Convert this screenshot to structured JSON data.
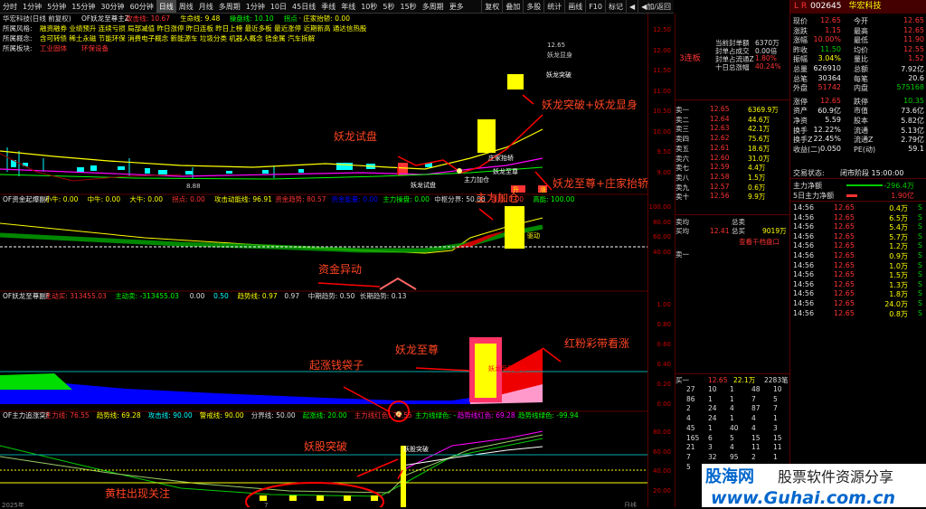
{
  "toolbar": {
    "name": "华宏科技(日线 前复权)",
    "periods": [
      "分时",
      "1分钟",
      "5分钟",
      "15分钟",
      "30分钟",
      "60分钟",
      "日线",
      "周线",
      "月线",
      "多周期",
      "1分钟",
      "10日",
      "45日线",
      "季线",
      "年线",
      "10秒",
      "5秒",
      "15秒",
      "多周期",
      "更多"
    ],
    "active": "日线",
    "right": [
      "复权",
      "叠加",
      "多股",
      "统计",
      "画线",
      "F10",
      "标记",
      "◀",
      "◀加/返回"
    ]
  },
  "main_chart": {
    "legend": [
      {
        "t": "OF妖龙至尊主Z",
        "c": "#eee"
      },
      {
        "t": "攻击线: 10.67",
        "c": "#f33"
      },
      {
        "t": "生命线: 9.48",
        "c": "#ff0"
      },
      {
        "t": "操盘线: 10.10",
        "c": "#0f0"
      },
      {
        "t": "拐点",
        "c": "#0f0"
      },
      {
        "t": "· 庄家抬轿: 0.00",
        "c": "#ff0"
      }
    ],
    "info": [
      {
        "k": "所属风格:",
        "v": "融资融券 业绩预升 连续亏损 局部减值 昨日涨停 昨日连板 昨日上榜 最近多板 最近涨停 近期新高 通达信热股"
      },
      {
        "k": "所属概念:",
        "v": "含可转债 稀土永磁 节能环保 消费电子概念 新能源车 垃圾分类 机器人概念 锆金属 汽车拆解"
      },
      {
        "k": "所属板块:",
        "v": "工业固体",
        "v2": "环保设备"
      }
    ],
    "y_ticks": [
      "12.50",
      "12.00",
      "11.50",
      "11.00",
      "10.50",
      "10.00",
      "9.50",
      "9.00"
    ],
    "marks": {
      "price_top": "12.65",
      "yaolong_show": "妖龙显身",
      "yaolong_break": "妖龙突破",
      "zhuang": "庄家抬轿",
      "zhizun": "妖龙至尊",
      "zhuli": "主力加仓",
      "shipan": "妖龙试盘",
      "low": "8.88",
      "t1": "升",
      "t2": "涨"
    }
  },
  "sub1": {
    "legend": [
      {
        "t": "OF资金起爆副F",
        "c": "#eee"
      },
      {
        "t": "小牛: 0.00",
        "c": "#ff0"
      },
      {
        "t": "中牛: 0.00",
        "c": "#ff0"
      },
      {
        "t": "大牛: 0.00",
        "c": "#ff0"
      },
      {
        "t": "拐点: 0.00",
        "c": "#f33"
      },
      {
        "t": "攻击动能线: 96.91",
        "c": "#ff0"
      },
      {
        "t": "资金趋势: 80.57",
        "c": "#f33"
      },
      {
        "t": "资金能量: 0.00",
        "c": "#00f"
      },
      {
        "t": "主力操盘: 0.00",
        "c": "#0f0"
      },
      {
        "t": "中枢分界: 50.00",
        "c": "#ddd"
      },
      {
        "t": "强势: 0.00",
        "c": "#f33"
      },
      {
        "t": "高能: 100.00",
        "c": "#0f0"
      }
    ],
    "y_ticks": [
      "100.00",
      "80.00",
      "60.00",
      "40.00"
    ],
    "marks": {
      "sig": "资金异动",
      "b1": "妖龙",
      "b2": "驱动"
    }
  },
  "sub2": {
    "legend": [
      {
        "t": "OF妖龙至尊副F",
        "c": "#eee"
      },
      {
        "t": "主动买: 313455.03",
        "c": "#f33"
      },
      {
        "t": "主动卖: -313455.03",
        "c": "#0f0"
      },
      {
        "t": "0.00",
        "c": "#ddd"
      },
      {
        "t": "0.50",
        "c": "#0ff"
      },
      {
        "t": "趋势线: 0.97",
        "c": "#ff0"
      },
      {
        "t": "0.97",
        "c": "#ddd"
      },
      {
        "t": "中期趋势: 0.50",
        "c": "#ddd"
      },
      {
        "t": "长期趋势: 0.13",
        "c": "#ddd"
      }
    ],
    "y_ticks": [
      "1.00",
      "0.80",
      "0.60",
      "0.40",
      "0.20",
      "0.00"
    ],
    "marks": {
      "box": "妖龙至尊登场"
    }
  },
  "sub3": {
    "legend": [
      {
        "t": "OF主力追涨突F",
        "c": "#eee"
      },
      {
        "t": "主力线: 76.55",
        "c": "#f33"
      },
      {
        "t": "趋势线: 69.28",
        "c": "#ff0"
      },
      {
        "t": "攻击线: 90.00",
        "c": "#0ff"
      },
      {
        "t": "警戒线: 90.00",
        "c": "#ff0"
      },
      {
        "t": "分界线: 50.00",
        "c": "#ddd"
      },
      {
        "t": "起涨线: 20.00",
        "c": "#0f0"
      },
      {
        "t": "主力线红色: 76.55",
        "c": "#f33"
      },
      {
        "t": "主力线绿色: -",
        "c": "#0f0"
      },
      {
        "t": "趋势线红色: 69.28",
        "c": "#f0f"
      },
      {
        "t": "趋势线绿色: -99.94",
        "c": "#0f0"
      }
    ],
    "y_ticks": [
      "80.00",
      "60.00",
      "40.00",
      "20.00"
    ],
    "marks": {
      "top": "妖股突破",
      "date": "2025年",
      "date2": "7",
      "tf": "日线"
    }
  },
  "annotations": {
    "a1": "妖龙试盘",
    "a2": "妖龙突破+妖龙显身",
    "a3": "妖龙至尊+庄家抬轿",
    "a4": "主力加仓",
    "a5": "资金异动",
    "a6": "起涨钱袋子",
    "a7": "妖龙至尊",
    "a8": "红粉彩带看涨",
    "a9": "妖股突破",
    "a10": "黄柱出现关注"
  },
  "mid": {
    "title": "3连板",
    "stats": [
      {
        "k": "当前封单额",
        "v": "6370万"
      },
      {
        "k": "封单占成交",
        "v": "0.00倍"
      },
      {
        "k": "封单占流通Z",
        "v": "1.80%"
      },
      {
        "k": "十日总涨幅",
        "v": "40.24%"
      }
    ],
    "sells": [
      {
        "k": "卖十",
        "p": "12.56",
        "v": "9.9万"
      },
      {
        "k": "卖九",
        "p": "12.57",
        "v": "0.6万"
      },
      {
        "k": "卖八",
        "p": "12.58",
        "v": "1.5万"
      },
      {
        "k": "卖七",
        "p": "12.59",
        "v": "4.4万"
      },
      {
        "k": "卖六",
        "p": "12.60",
        "v": "31.0万"
      },
      {
        "k": "卖五",
        "p": "12.61",
        "v": "18.6万"
      },
      {
        "k": "卖四",
        "p": "12.62",
        "v": "75.6万"
      },
      {
        "k": "卖三",
        "p": "12.63",
        "v": "42.1万"
      },
      {
        "k": "卖二",
        "p": "12.64",
        "v": "44.6万"
      },
      {
        "k": "卖一",
        "p": "12.65",
        "v": "6369.9万"
      }
    ],
    "avg": {
      "a": "卖均",
      "b": "总卖",
      "c": "买均",
      "d": "12.41",
      "e": "总买",
      "f": "9019万"
    },
    "link": "查看千档盘口",
    "buy1": "卖一",
    "queue_head": {
      "a": "买一",
      "b": "12.65",
      "c": "22.1万",
      "d": "2283笔"
    },
    "queue": [
      [
        "27",
        "10",
        "1",
        "48",
        "10"
      ],
      [
        "86",
        "1",
        "1",
        "7",
        "5"
      ],
      [
        "2",
        "24",
        "4",
        "87",
        "7"
      ],
      [
        "4",
        "24",
        "1",
        "4",
        "1"
      ],
      [
        "45",
        "1",
        "40",
        "4",
        "3"
      ],
      [
        "165",
        "6",
        "5",
        "15",
        "15"
      ],
      [
        "21",
        "3",
        "4",
        "11",
        "11"
      ],
      [
        "7",
        "32",
        "95",
        "2",
        "1"
      ],
      [
        "5",
        "19",
        "5",
        "...",
        ""
      ]
    ]
  },
  "rp": {
    "code": "002645",
    "name": "华宏科技",
    "badge": "L  R",
    "kv": [
      [
        "现价",
        "12.65",
        "今开",
        "12.65"
      ],
      [
        "涨跌",
        "1.15",
        "最高",
        "12.65"
      ],
      [
        "涨幅",
        "10.00%",
        "最低",
        "11.90"
      ],
      [
        "昨收",
        "11.50",
        "均价",
        "12.55"
      ],
      [
        "振幅",
        "3.04%",
        "量比",
        "1.52"
      ],
      [
        "总量",
        "626910",
        "总额",
        "7.92亿"
      ],
      [
        "总笔",
        "30364",
        "每笔",
        "20.6"
      ],
      [
        "外盘",
        "51742",
        "内盘",
        "575168"
      ],
      [
        "涨停",
        "12.65",
        "跌停",
        "10.35"
      ],
      [
        "资产",
        "60.9亿",
        "市值",
        "73.6亿"
      ],
      [
        "净资",
        "5.59",
        "股本",
        "5.82亿"
      ],
      [
        "换手",
        "12.22%",
        "流通",
        "5.13亿"
      ],
      [
        "换手Z",
        "22.45%",
        "流通Z",
        "2.79亿"
      ],
      [
        "收益(二)",
        "0.050",
        "PE(动)",
        "59.1"
      ]
    ],
    "state_k": "交易状态:",
    "state_v": "闭市阶段 15:00:00",
    "net1_k": "主力净额",
    "net1_v": "-296.4万",
    "net2_k": "5日主力净额",
    "net2_v": "1.90亿",
    "ticks": [
      [
        "14:56",
        "12.65",
        "0.4万",
        "S"
      ],
      [
        "14:56",
        "12.65",
        "6.5万",
        "S"
      ],
      [
        "14:56",
        "12.65",
        "5.4万",
        "S"
      ],
      [
        "14:56",
        "12.65",
        "5.7万",
        "S"
      ],
      [
        "14:56",
        "12.65",
        "1.2万",
        "S"
      ],
      [
        "14:56",
        "12.65",
        "0.9万",
        "S"
      ],
      [
        "14:56",
        "12.65",
        "1.0万",
        "S"
      ],
      [
        "14:56",
        "12.65",
        "1.5万",
        "S"
      ],
      [
        "14:56",
        "12.65",
        "1.3万",
        "S"
      ],
      [
        "14:56",
        "12.65",
        "1.8万",
        "S"
      ],
      [
        "14:56",
        "12.65",
        "24.0万",
        "S"
      ],
      [
        "14:56",
        "12.65",
        "0.8万",
        "S"
      ]
    ]
  },
  "watermark": {
    "t1": "股海网",
    "t2": "股票软件资源分享",
    "url": "www.Guhai.com.cn"
  }
}
